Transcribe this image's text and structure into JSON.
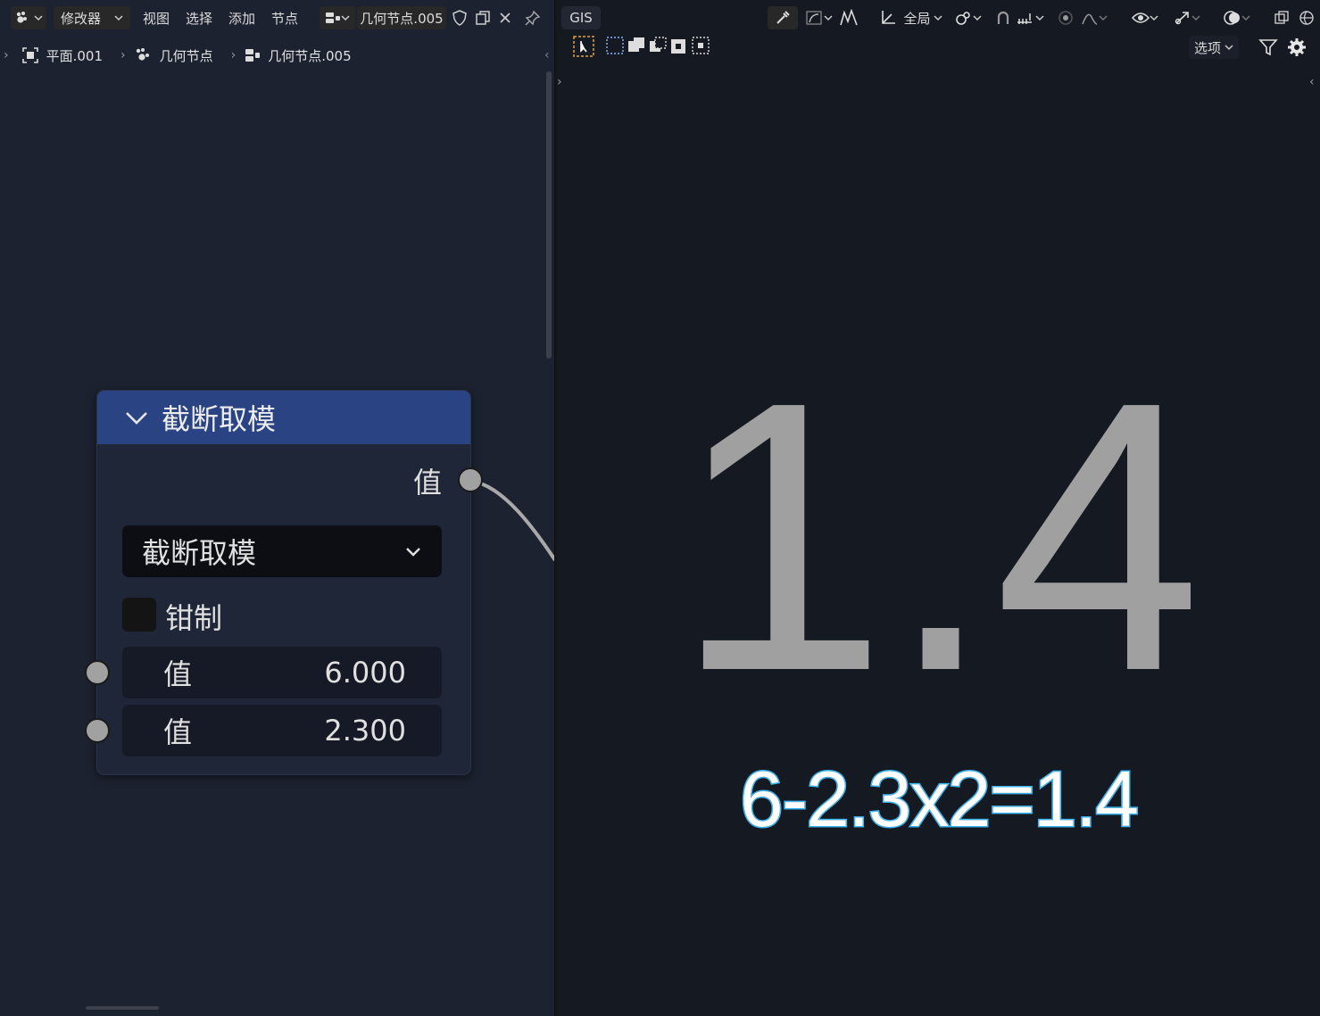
{
  "left_editor": {
    "header": {
      "editor_type": "修改器",
      "menus": [
        "视图",
        "选择",
        "添加",
        "节点"
      ],
      "node_group_name": "几何节点.005"
    },
    "breadcrumb": [
      "平面.001",
      "几何节点",
      "几何节点.005"
    ]
  },
  "node": {
    "title": "截断取模",
    "output_label": "值",
    "operation": "截断取模",
    "clamp_label": "钳制",
    "clamp_checked": false,
    "inputs": [
      {
        "label": "值",
        "value": "6.000"
      },
      {
        "label": "值",
        "value": "2.300"
      }
    ]
  },
  "right_editor": {
    "header": {
      "gis_label": "GIS",
      "transform_orientation": "全局",
      "options_label": "选项"
    },
    "viewer": {
      "result_display": "1.4",
      "formula": "6-2.3x2=1.4"
    }
  },
  "colors": {
    "node_header": "#2a4382",
    "node_body": "#1f2638",
    "socket": "#a1a1a1",
    "formula_outline": "#3bb5f0",
    "big_number": "#a0a0a0"
  }
}
